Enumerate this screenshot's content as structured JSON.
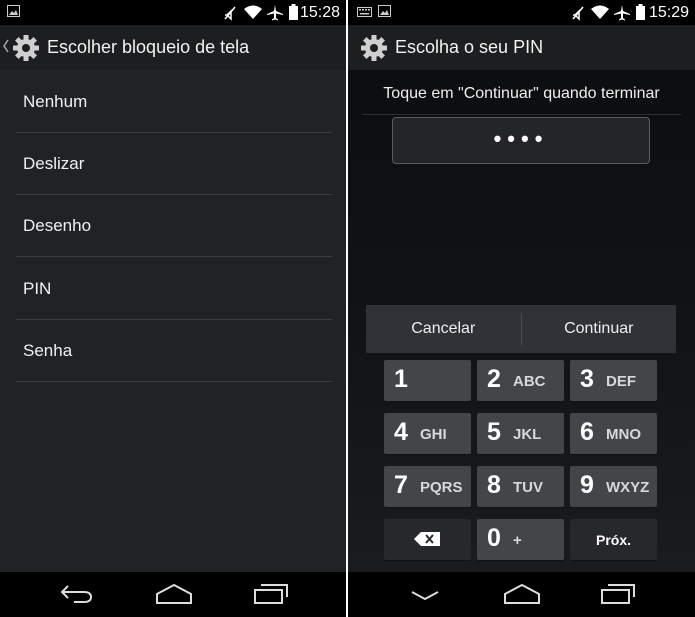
{
  "left": {
    "status": {
      "time": "15:28"
    },
    "actionbar": {
      "title": "Escolher bloqueio de tela"
    },
    "options": [
      "Nenhum",
      "Deslizar",
      "Desenho",
      "PIN",
      "Senha"
    ]
  },
  "right": {
    "status": {
      "time": "15:29"
    },
    "actionbar": {
      "title": "Escolha o seu PIN"
    },
    "prompt": "Toque em \"Continuar\" quando terminar",
    "pin_field": "••••",
    "buttons": {
      "cancel": "Cancelar",
      "continue": "Continuar"
    },
    "keys": [
      {
        "num": "1",
        "letters": ""
      },
      {
        "num": "2",
        "letters": "ABC"
      },
      {
        "num": "3",
        "letters": "DEF"
      },
      {
        "num": "4",
        "letters": "GHI"
      },
      {
        "num": "5",
        "letters": "JKL"
      },
      {
        "num": "6",
        "letters": "MNO"
      },
      {
        "num": "7",
        "letters": "PQRS"
      },
      {
        "num": "8",
        "letters": "TUV"
      },
      {
        "num": "9",
        "letters": "WXYZ"
      }
    ],
    "zero_key": {
      "num": "0",
      "letters": "+"
    },
    "next_key": "Próx."
  },
  "icons": {
    "back": "back-icon",
    "home": "home-icon",
    "recents": "recents-icon",
    "settings": "gear-icon",
    "wifi": "wifi-icon",
    "airplane": "airplane-icon",
    "battery": "battery-icon",
    "muted": "vibrate-mute-icon",
    "backspace": "backspace-icon",
    "hide_keyboard": "chevron-down-icon"
  }
}
